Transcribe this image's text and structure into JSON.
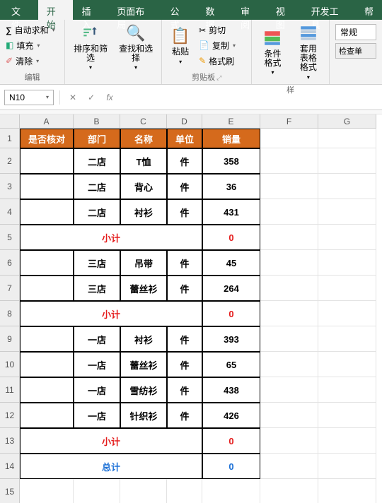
{
  "tabs": {
    "file": "文件",
    "home": "开始",
    "insert": "插入",
    "layout": "页面布局",
    "formulas": "公式",
    "data": "数据",
    "review": "审阅",
    "view": "视图",
    "dev": "开发工具",
    "help": "帮"
  },
  "ribbon": {
    "autosum": "自动求和",
    "fill": "填充",
    "clear": "清除",
    "edit_group": "编辑",
    "sort": "排序和筛选",
    "find": "查找和选择",
    "paste": "粘贴",
    "cut": "剪切",
    "copy": "复制",
    "format_painter": "格式刷",
    "clipboard_group": "剪贴板",
    "cond_format": "条件格式",
    "table_format": "套用\n表格格式",
    "styles_group": "样",
    "general": "常规",
    "check": "检查单"
  },
  "formula_bar": {
    "cell_ref": "N10",
    "fx": "fx"
  },
  "columns": [
    "A",
    "B",
    "C",
    "D",
    "E",
    "F",
    "G"
  ],
  "rows": [
    "1",
    "2",
    "3",
    "4",
    "5",
    "6",
    "7",
    "8",
    "9",
    "10",
    "11",
    "12",
    "13",
    "14",
    "15"
  ],
  "table": {
    "headers": {
      "a": "是否核对",
      "b": "部门",
      "c": "名称",
      "d": "单位",
      "e": "销量"
    },
    "r2": {
      "b": "二店",
      "c": "T恤",
      "d": "件",
      "e": "358"
    },
    "r3": {
      "b": "二店",
      "c": "背心",
      "d": "件",
      "e": "36"
    },
    "r4": {
      "b": "二店",
      "c": "衬衫",
      "d": "件",
      "e": "431"
    },
    "r5": {
      "label": "小计",
      "val": "0"
    },
    "r6": {
      "b": "三店",
      "c": "吊带",
      "d": "件",
      "e": "45"
    },
    "r7": {
      "b": "三店",
      "c": "蕾丝衫",
      "d": "件",
      "e": "264"
    },
    "r8": {
      "label": "小计",
      "val": "0"
    },
    "r9": {
      "b": "一店",
      "c": "衬衫",
      "d": "件",
      "e": "393"
    },
    "r10": {
      "b": "一店",
      "c": "蕾丝衫",
      "d": "件",
      "e": "65"
    },
    "r11": {
      "b": "一店",
      "c": "雪纺衫",
      "d": "件",
      "e": "438"
    },
    "r12": {
      "b": "一店",
      "c": "针织衫",
      "d": "件",
      "e": "426"
    },
    "r13": {
      "label": "小计",
      "val": "0"
    },
    "r14": {
      "label": "总计",
      "val": "0"
    }
  },
  "chart_data": {
    "type": "table",
    "columns": [
      "是否核对",
      "部门",
      "名称",
      "单位",
      "销量"
    ],
    "rows": [
      [
        "",
        "二店",
        "T恤",
        "件",
        358
      ],
      [
        "",
        "二店",
        "背心",
        "件",
        36
      ],
      [
        "",
        "二店",
        "衬衫",
        "件",
        431
      ],
      [
        "小计",
        "",
        "",
        "",
        0
      ],
      [
        "",
        "三店",
        "吊带",
        "件",
        45
      ],
      [
        "",
        "三店",
        "蕾丝衫",
        "件",
        264
      ],
      [
        "小计",
        "",
        "",
        "",
        0
      ],
      [
        "",
        "一店",
        "衬衫",
        "件",
        393
      ],
      [
        "",
        "一店",
        "蕾丝衫",
        "件",
        65
      ],
      [
        "",
        "一店",
        "雪纺衫",
        "件",
        438
      ],
      [
        "",
        "一店",
        "针织衫",
        "件",
        426
      ],
      [
        "小计",
        "",
        "",
        "",
        0
      ],
      [
        "总计",
        "",
        "",
        "",
        0
      ]
    ]
  }
}
